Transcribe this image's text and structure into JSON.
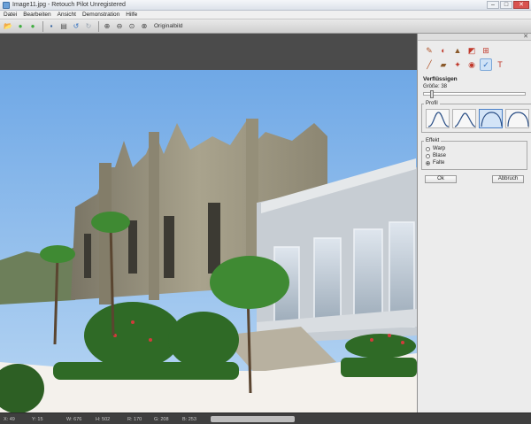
{
  "window": {
    "title": "Image11.jpg - Retouch Pilot Unregistered",
    "controls": {
      "minimize": "–",
      "maximize": "□",
      "close": "✕"
    }
  },
  "menu": [
    "Datei",
    "Bearbeiten",
    "Ansicht",
    "Demonstration",
    "Hilfe"
  ],
  "toolbar": {
    "buttons": [
      {
        "name": "open-icon",
        "glyph": "📂",
        "color": "#e0b03a"
      },
      {
        "name": "back-icon",
        "glyph": "●",
        "color": "#3fae3f"
      },
      {
        "name": "forward-icon",
        "glyph": "●",
        "color": "#3fae3f"
      },
      {
        "name": "save-icon",
        "glyph": "▪",
        "color": "#2f5f9e"
      },
      {
        "name": "print-icon",
        "glyph": "▤",
        "color": "#555555"
      },
      {
        "name": "undo-icon",
        "glyph": "↺",
        "color": "#2f6fc0"
      },
      {
        "name": "redo-icon",
        "glyph": "↻",
        "color": "#9aa4b0"
      },
      {
        "name": "zoom-in-icon",
        "glyph": "⊕",
        "color": "#444444"
      },
      {
        "name": "zoom-out-icon",
        "glyph": "⊖",
        "color": "#444444"
      },
      {
        "name": "zoom-fit-icon",
        "glyph": "⊙",
        "color": "#444444"
      },
      {
        "name": "zoom-actual-icon",
        "glyph": "⊗",
        "color": "#444444"
      }
    ],
    "original_label": "Originalbild"
  },
  "panel": {
    "tools": [
      {
        "name": "brush-tool-icon",
        "glyph": "✎",
        "color": "#b0542a",
        "active": false
      },
      {
        "name": "clone-tool-icon",
        "glyph": "◐",
        "color": "#c0392b",
        "active": false
      },
      {
        "name": "stamp-tool-icon",
        "glyph": "▲",
        "color": "#8a5a2b",
        "active": false
      },
      {
        "name": "levels-tool-icon",
        "glyph": "◩",
        "color": "#c0392b",
        "active": false
      },
      {
        "name": "crop-tool-icon",
        "glyph": "⊞",
        "color": "#c0392b",
        "active": false
      },
      {
        "name": "spacer",
        "glyph": "",
        "color": "#000000",
        "active": false
      },
      {
        "name": "pen-tool-icon",
        "glyph": "╱",
        "color": "#b0542a",
        "active": false
      },
      {
        "name": "eraser-tool-icon",
        "glyph": "▰",
        "color": "#8a5a2b",
        "active": false
      },
      {
        "name": "patch-tool-icon",
        "glyph": "✦",
        "color": "#c0392b",
        "active": false
      },
      {
        "name": "redeye-tool-icon",
        "glyph": "◉",
        "color": "#c0392b",
        "active": false
      },
      {
        "name": "liquify-tool-icon",
        "glyph": "✓",
        "color": "#2f6fc0",
        "active": true
      },
      {
        "name": "text-tool-icon",
        "glyph": "T",
        "color": "#c0392b",
        "active": false
      }
    ],
    "section_title": "Verflüssigen",
    "size_label": "Größe: 38",
    "size_value": 0.06,
    "profile_legend": "Profil",
    "profile_selected_index": 2,
    "effect_legend": "Effekt",
    "effects": [
      "Warp",
      "Blase",
      "Falte"
    ],
    "effect_selected_index": 2,
    "ok_label": "Ok",
    "cancel_label": "Abbruch"
  },
  "status": {
    "x": "X: 49",
    "y": "Y: 15",
    "w": "W: 676",
    "h": "H: 502",
    "r": "R: 170",
    "g": "G: 208",
    "b": "B: 253"
  }
}
